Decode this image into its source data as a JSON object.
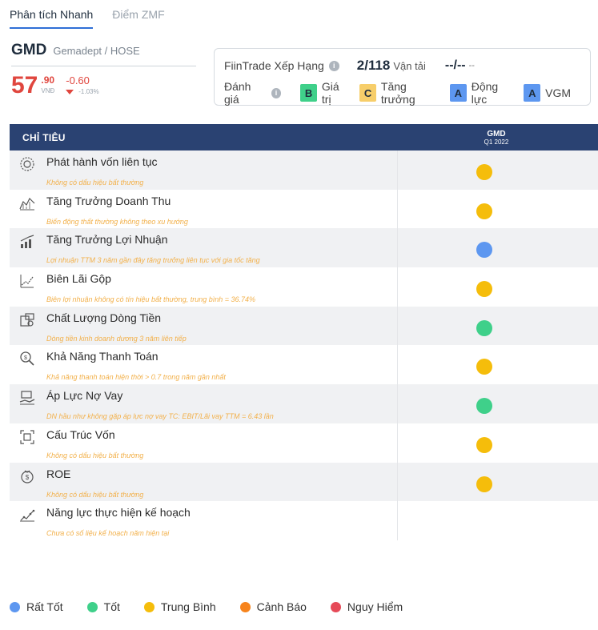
{
  "tabs": [
    {
      "label": "Phân tích Nhanh",
      "active": true
    },
    {
      "label": "Điểm ZMF",
      "active": false
    }
  ],
  "stock": {
    "ticker": "GMD",
    "exchange": "Gemadept / HOSE",
    "price_int": "57",
    "price_dec": ".90",
    "unit": "VNĐ",
    "change": "-0.60",
    "change_pct": "-1.03%"
  },
  "rating": {
    "label": "FiinTrade Xếp Hạng",
    "rank": "2/118",
    "sector": "Vận tải",
    "dash_big": "--/--",
    "dash_small": "--",
    "assess_label": "Đánh giá",
    "grades": [
      {
        "letter": "B",
        "text": "Giá trị",
        "color": "#3fd08a"
      },
      {
        "letter": "C",
        "text": "Tăng trưởng",
        "color": "#f7ce6a"
      },
      {
        "letter": "A",
        "text": "Động lực",
        "color": "#5d97f0"
      },
      {
        "letter": "A",
        "text": "VGM",
        "color": "#5d97f0"
      }
    ]
  },
  "table": {
    "header_label": "CHỈ TIÊU",
    "col_ticker": "GMD",
    "col_period": "Q1 2022",
    "rows": [
      {
        "title": "Phát hành vốn liên tục",
        "note": "Không có dấu hiệu bất thường",
        "icon": "gear-icon",
        "status": "Trung Bình"
      },
      {
        "title": "Tăng Trưởng Doanh Thu",
        "note": "Biến động thất thường không theo xu hướng",
        "icon": "area-chart-icon",
        "status": "Trung Bình"
      },
      {
        "title": "Tăng Trưởng Lợi Nhuận",
        "note": "Lợi nhuận TTM 3 năm gần đây tăng trưởng liên tục với gia tốc tăng",
        "icon": "bar-growth-icon",
        "status": "Rất Tốt"
      },
      {
        "title": "Biên Lãi Gộp",
        "note": "Biên lợi nhuận không có tín hiệu bất thường, trung bình = 36.74%",
        "icon": "trend-chart-icon",
        "status": "Trung Bình"
      },
      {
        "title": "Chất Lượng Dòng Tiền",
        "note": "Dòng tiền kinh doanh dương 3 năm liên tiếp",
        "icon": "cash-flow-icon",
        "status": "Tốt"
      },
      {
        "title": "Khả Năng Thanh Toán",
        "note": "Khả năng thanh toán hiện thời > 0.7 trong năm gần nhất",
        "icon": "magnifier-coin-icon",
        "status": "Trung Bình"
      },
      {
        "title": "Áp Lực Nợ Vay",
        "note": "DN hầu như không gặp áp lực nợ vay TC: EBIT/Lãi vay TTM = 6.43 lần",
        "icon": "debt-hand-icon",
        "status": "Tốt"
      },
      {
        "title": "Cấu Trúc Vốn",
        "note": "Không có dấu hiệu bất thường",
        "icon": "structure-icon",
        "status": "Trung Bình"
      },
      {
        "title": "ROE",
        "note": "Không có dấu hiệu bất thường",
        "icon": "money-bag-icon",
        "status": "Trung Bình"
      },
      {
        "title": "Năng lực thực hiện kế hoạch",
        "note": "Chưa có số liệu kế hoạch năm hiện tại",
        "icon": "growth-plan-icon",
        "status": ""
      }
    ]
  },
  "legend": [
    {
      "label": "Rất Tốt",
      "color": "#5d97f0"
    },
    {
      "label": "Tốt",
      "color": "#3fd08a"
    },
    {
      "label": "Trung Bình",
      "color": "#f5bd0b"
    },
    {
      "label": "Cảnh Báo",
      "color": "#f7841c"
    },
    {
      "label": "Nguy Hiểm",
      "color": "#e64a58"
    }
  ]
}
